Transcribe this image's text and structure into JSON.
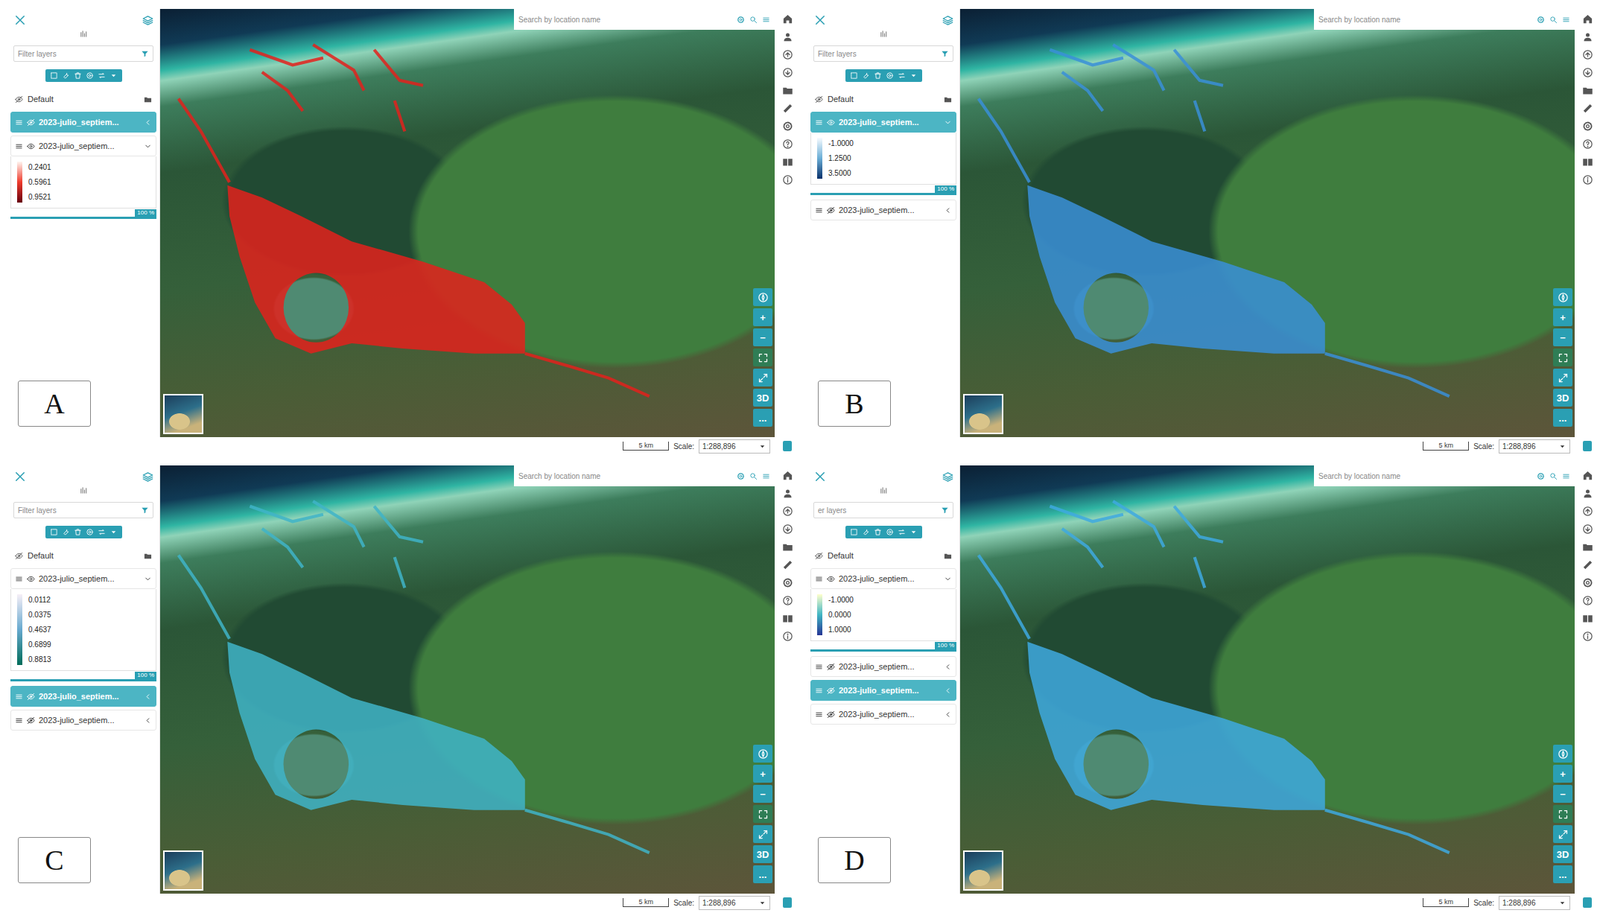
{
  "panels": [
    {
      "letter": "A",
      "search_placeholder": "Search by location name",
      "filter_placeholder": "Filter layers",
      "groups": [
        {
          "label": "Default",
          "visible": false
        }
      ],
      "layers": [
        {
          "label": "2023-julio_septiem...",
          "visible": false,
          "selected": true,
          "expanded": false
        },
        {
          "label": "2023-julio_septiem...",
          "visible": true,
          "selected": false,
          "expanded": true,
          "legend": {
            "values": [
              "0.2401",
              "0.5961",
              "0.9521"
            ],
            "ramp": [
              "#fff5f0",
              "#ef3b2c",
              "#67000d"
            ]
          },
          "opacity": {
            "level": 1,
            "reading": "100 %"
          }
        }
      ],
      "overlay": {
        "color": "#e3211c"
      },
      "map_controls": [
        "+",
        "−",
        "3D",
        "..."
      ],
      "scale": {
        "bar": "5 km",
        "label": "Scale:",
        "value": "1:288,896"
      }
    },
    {
      "letter": "B",
      "search_placeholder": "Search by location name",
      "filter_placeholder": "Filter layers",
      "groups": [
        {
          "label": "Default",
          "visible": false
        }
      ],
      "layers": [
        {
          "label": "2023-julio_septiem...",
          "visible": true,
          "selected": true,
          "expanded": true,
          "legend": {
            "values": [
              "-1.0000",
              "1.2500",
              "3.5000"
            ],
            "ramp": [
              "#f7fbff",
              "#6baed6",
              "#08306b"
            ]
          },
          "opacity": {
            "level": 1,
            "reading": "100 %"
          }
        },
        {
          "label": "2023-julio_septiem...",
          "visible": false,
          "selected": false,
          "expanded": false
        }
      ],
      "overlay": {
        "color": "#3a8fd8"
      },
      "map_controls": [
        "+",
        "−",
        "3D",
        "..."
      ],
      "scale": {
        "bar": "5 km",
        "label": "Scale:",
        "value": "1:288,896"
      }
    },
    {
      "letter": "C",
      "search_placeholder": "Search by location name",
      "filter_placeholder": "Filter layers",
      "groups": [
        {
          "label": "Default",
          "visible": false
        }
      ],
      "layers": [
        {
          "label": "2023-julio_septiem...",
          "visible": true,
          "selected": false,
          "expanded": true,
          "legend": {
            "values": [
              "0.0112",
              "0.0375",
              "0.4637",
              "0.6899",
              "0.8813"
            ],
            "ramp": [
              "#f6eff7",
              "#67a9cf",
              "#016c59"
            ]
          },
          "opacity": {
            "level": 1,
            "reading": "100 %"
          }
        },
        {
          "label": "2023-julio_septiem...",
          "visible": false,
          "selected": true,
          "expanded": false
        },
        {
          "label": "2023-julio_septiem...",
          "visible": false,
          "selected": false,
          "expanded": false
        }
      ],
      "overlay": {
        "color": "#40b4c8"
      },
      "map_controls": [
        "+",
        "−",
        "3D",
        "..."
      ],
      "scale": {
        "bar": "5 km",
        "label": "Scale:",
        "value": "1:288,896"
      }
    },
    {
      "letter": "D",
      "search_placeholder": "Search by location name",
      "filter_placeholder": "er layers",
      "groups": [
        {
          "label": "Default",
          "visible": false
        }
      ],
      "layers": [
        {
          "label": "2023-julio_septiem...",
          "visible": true,
          "selected": false,
          "expanded": true,
          "legend": {
            "values": [
              "-1.0000",
              "0.0000",
              "1.0000"
            ],
            "ramp": [
              "#ffffcc",
              "#41b6c4",
              "#253494"
            ]
          },
          "opacity": {
            "level": 1,
            "reading": "100 %"
          }
        },
        {
          "label": "2023-julio_septiem...",
          "visible": false,
          "selected": false,
          "expanded": false
        },
        {
          "label": "2023-julio_septiem...",
          "visible": false,
          "selected": true,
          "expanded": false
        },
        {
          "label": "2023-julio_septiem...",
          "visible": false,
          "selected": false,
          "expanded": false
        }
      ],
      "overlay": {
        "color": "#3ea9e0"
      },
      "map_controls": [
        "+",
        "−",
        "3D",
        "..."
      ],
      "scale": {
        "bar": "5 km",
        "label": "Scale:",
        "value": "1:288,896"
      }
    }
  ]
}
